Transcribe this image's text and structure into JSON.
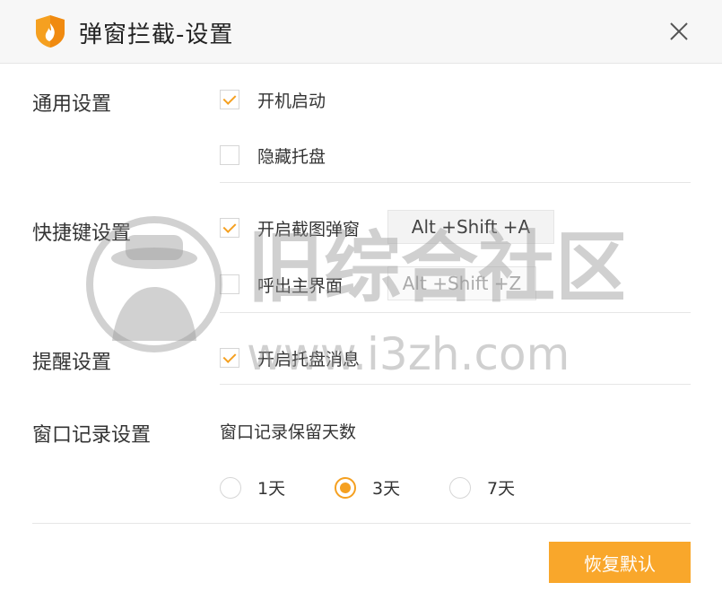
{
  "window": {
    "title": "弹窗拦截-设置",
    "accent": "#f5a020"
  },
  "sections": {
    "general": {
      "label": "通用设置",
      "options": [
        {
          "label": "开机启动",
          "checked": true
        },
        {
          "label": "隐藏托盘",
          "checked": false
        }
      ]
    },
    "hotkey": {
      "label": "快捷键设置",
      "options": [
        {
          "label": "开启截图弹窗",
          "checked": true,
          "key": "Alt +Shift +A"
        },
        {
          "label": "呼出主界面",
          "checked": false,
          "key": "Alt +Shift +Z"
        }
      ]
    },
    "reminder": {
      "label": "提醒设置",
      "options": [
        {
          "label": "开启托盘消息",
          "checked": true
        }
      ]
    },
    "records": {
      "label": "窗口记录设置",
      "subtitle": "窗口记录保留天数",
      "radios": [
        {
          "label": "1天",
          "checked": false
        },
        {
          "label": "3天",
          "checked": true
        },
        {
          "label": "7天",
          "checked": false
        }
      ]
    }
  },
  "footer": {
    "restore_label": "恢复默认"
  },
  "watermark": {
    "main": "旧综合社区",
    "url": "www.i3zh.com"
  }
}
